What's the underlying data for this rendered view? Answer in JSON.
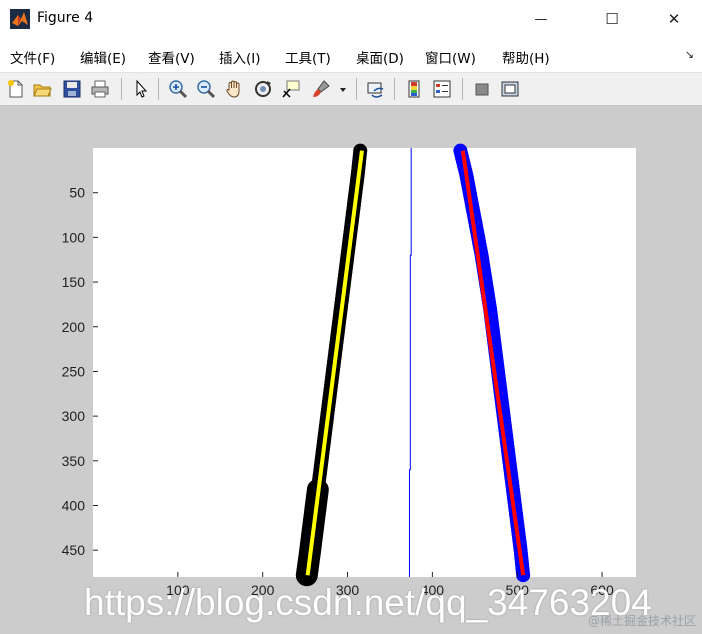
{
  "window": {
    "title": "Figure 4",
    "minimize_glyph": "—",
    "maximize_glyph": "☐",
    "close_glyph": "✕"
  },
  "menu": {
    "items": [
      "文件(F)",
      "编辑(E)",
      "查看(V)",
      "插入(I)",
      "工具(T)",
      "桌面(D)",
      "窗口(W)",
      "帮助(H)"
    ],
    "dock_glyph": "↘"
  },
  "toolbar": {
    "icons": [
      "new-figure-icon",
      "open-file-icon",
      "save-icon",
      "print-icon",
      "arrow-pointer-icon",
      "zoom-in-icon",
      "zoom-out-icon",
      "pan-hand-icon",
      "rotate-3d-icon",
      "data-cursor-icon",
      "brush-icon",
      "link-plot-icon",
      "colorbar-icon",
      "legend-icon",
      "hide-plot-tools-icon",
      "show-plot-tools-icon"
    ]
  },
  "chart_data": {
    "type": "scatter",
    "title": "",
    "xlabel": "",
    "ylabel": "",
    "xlim": [
      0,
      640
    ],
    "ylim": [
      0,
      480
    ],
    "y_reversed": true,
    "grid": false,
    "xticks": [
      100,
      200,
      300,
      400,
      500,
      600
    ],
    "yticks": [
      50,
      100,
      150,
      200,
      250,
      300,
      350,
      400,
      450
    ],
    "series": [
      {
        "kind": "points",
        "color": "#000000",
        "points": [
          [
            315,
            3
          ],
          [
            312,
            30
          ],
          [
            308,
            60
          ],
          [
            304,
            90
          ],
          [
            300,
            120
          ],
          [
            296,
            150
          ],
          [
            292,
            180
          ],
          [
            288,
            210
          ],
          [
            284,
            240
          ],
          [
            280,
            270
          ],
          [
            276,
            300
          ],
          [
            272,
            330
          ],
          [
            268,
            360
          ],
          [
            264,
            390
          ],
          [
            260,
            420
          ],
          [
            256,
            450
          ],
          [
            252,
            478
          ]
        ]
      },
      {
        "kind": "points",
        "color": "#0000ff",
        "points": [
          [
            433,
            3
          ],
          [
            440,
            30
          ],
          [
            446,
            60
          ],
          [
            452,
            90
          ],
          [
            458,
            120
          ],
          [
            463,
            150
          ],
          [
            468,
            180
          ],
          [
            472,
            210
          ],
          [
            476,
            240
          ],
          [
            480,
            270
          ],
          [
            484,
            300
          ],
          [
            488,
            330
          ],
          [
            492,
            360
          ],
          [
            496,
            390
          ],
          [
            500,
            420
          ],
          [
            504,
            450
          ],
          [
            507,
            478
          ]
        ]
      },
      {
        "kind": "line",
        "color": "#ffff00",
        "points": [
          [
            317,
            3
          ],
          [
            253,
            478
          ]
        ]
      },
      {
        "kind": "line",
        "color": "#ff0000",
        "points": [
          [
            436,
            3
          ],
          [
            507,
            478
          ]
        ]
      },
      {
        "kind": "line",
        "color": "#0000ff",
        "points": [
          [
            375,
            0
          ],
          [
            375,
            120
          ],
          [
            374,
            120
          ],
          [
            374,
            360
          ],
          [
            373,
            360
          ],
          [
            373,
            480
          ]
        ]
      }
    ]
  },
  "overlay": {
    "watermark": "https://blog.csdn.net/qq_34763204",
    "corner_mark": "@稀土掘金技术社区"
  }
}
